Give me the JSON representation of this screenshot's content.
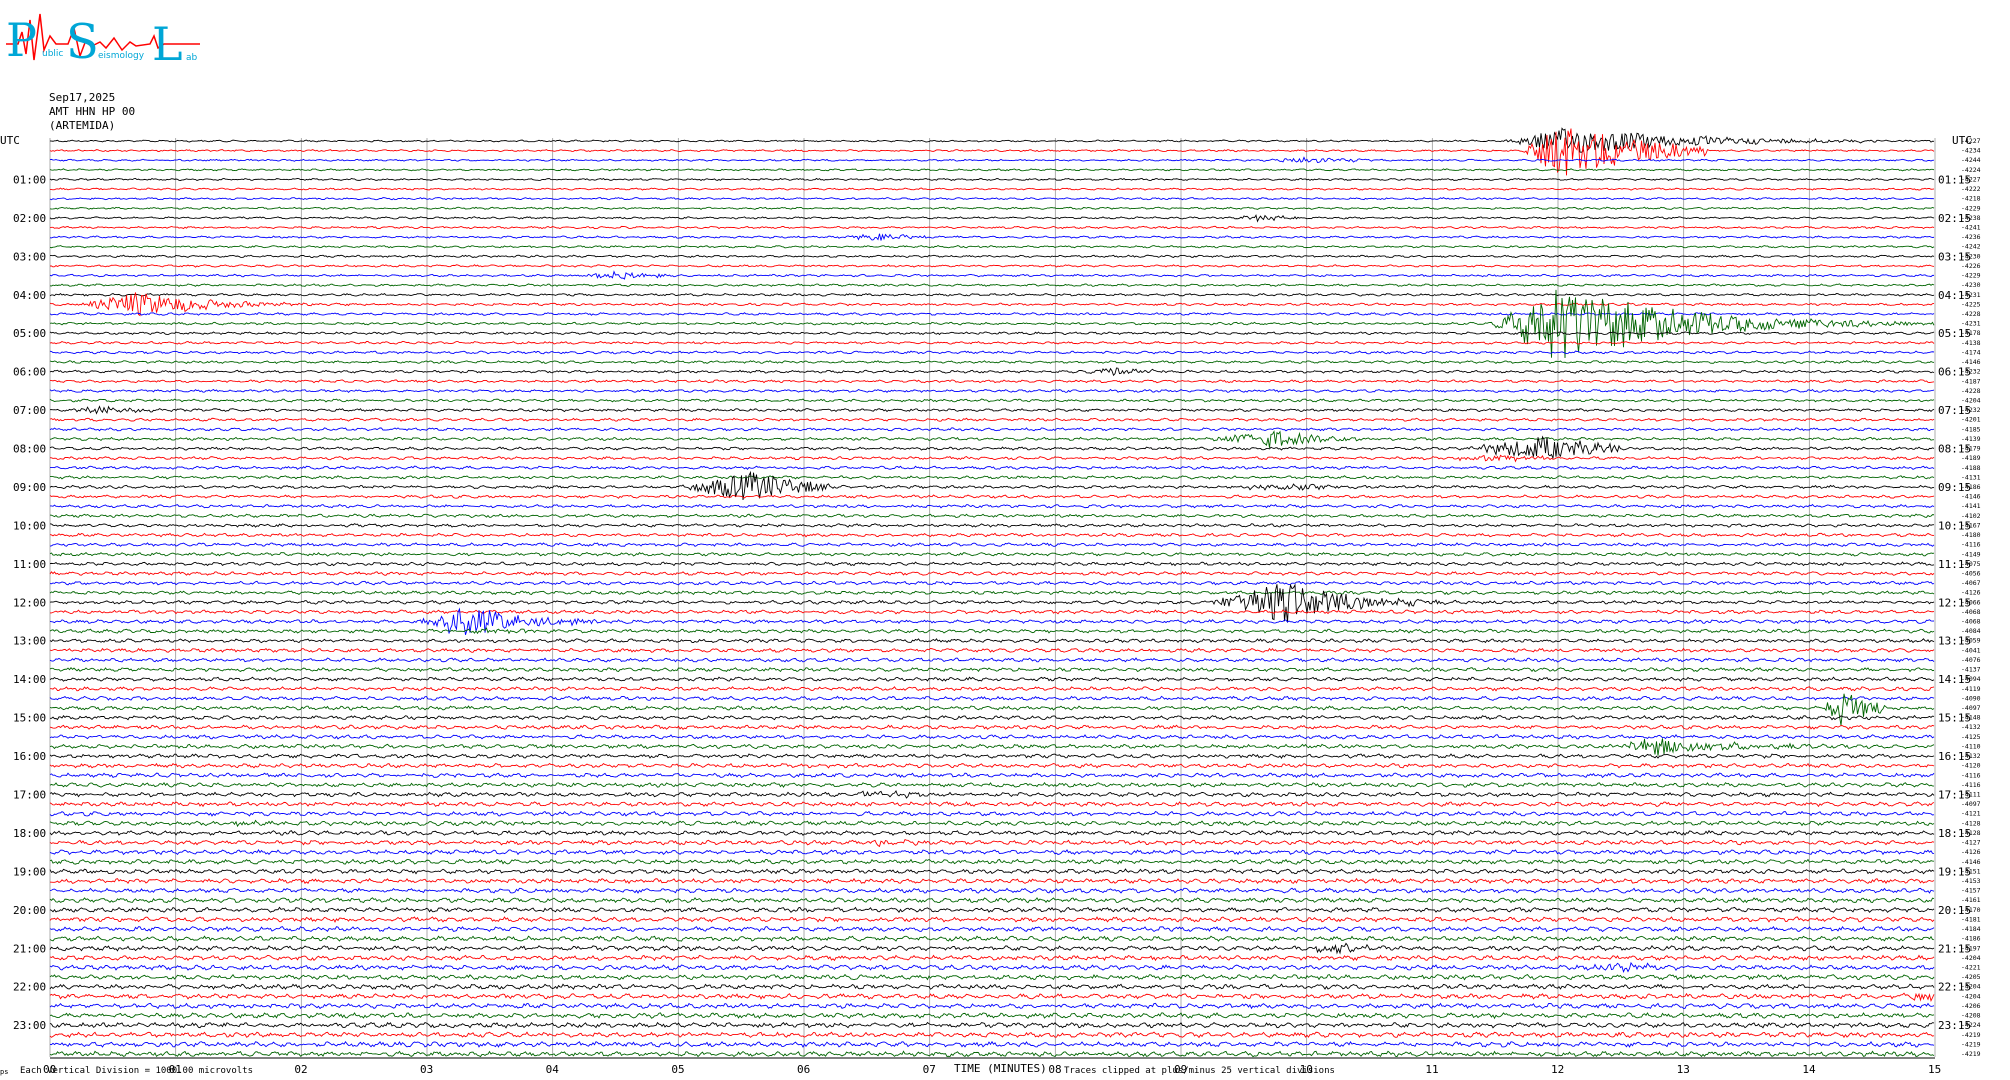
{
  "logo": {
    "letters": [
      "P",
      "S",
      "L"
    ],
    "words": [
      "ublic",
      "eismology",
      "ab"
    ]
  },
  "header": {
    "date": "Sep17,2025",
    "station": "AMT HHN HP 00",
    "location": "(ARTEMIDA)"
  },
  "axis": {
    "utc_label_left": "UTC",
    "utc_label_right": "UTC"
  },
  "footer": {
    "mark": "ps",
    "vertical_division": "Each Vertical Division = 1000.00 microvolts",
    "time_label": "TIME (MINUTES)",
    "clip_note": "Traces clipped at plus/minus 25 vertical divisions"
  },
  "chart_data": {
    "type": "line",
    "title": "",
    "xlabel": "TIME (MINUTES)",
    "ylabel": "UTC",
    "xlim": [
      0,
      15
    ],
    "x_ticks": [
      "00",
      "01",
      "02",
      "03",
      "04",
      "05",
      "06",
      "07",
      "08",
      "09",
      "10",
      "11",
      "12",
      "13",
      "14",
      "15"
    ],
    "left_hour_labels": [
      "01:00",
      "02:00",
      "03:00",
      "04:00",
      "05:00",
      "06:00",
      "07:00",
      "08:00",
      "09:00",
      "10:00",
      "11:00",
      "12:00",
      "13:00",
      "14:00",
      "15:00",
      "16:00",
      "17:00",
      "18:00",
      "19:00",
      "20:00",
      "21:00",
      "22:00",
      "23:00"
    ],
    "right_hour_labels": [
      "01:15",
      "02:15",
      "03:15",
      "04:15",
      "05:15",
      "06:15",
      "07:15",
      "08:15",
      "09:15",
      "10:15",
      "11:15",
      "12:15",
      "13:15",
      "14:15",
      "15:15",
      "16:15",
      "17:15",
      "18:15",
      "19:15",
      "20:15",
      "21:15",
      "22:15",
      "23:15"
    ],
    "trace_count": 96,
    "trace_minutes": 15,
    "trace_colors": [
      "#000000",
      "#ff0000",
      "#0000ff",
      "#006400"
    ],
    "right_values": [
      -4227,
      -4234,
      -4244,
      -4224,
      -4227,
      -4222,
      -4218,
      -4229,
      -4238,
      -4241,
      -4236,
      -4242,
      -4230,
      -4226,
      -4229,
      -4230,
      -4231,
      -4225,
      -4228,
      -4231,
      -4178,
      -4138,
      -4174,
      -4146,
      -4232,
      -4187,
      -4228,
      -4204,
      -4232,
      -4201,
      -4185,
      -4139,
      -4179,
      -4189,
      -4188,
      -4131,
      -4186,
      -4146,
      -4141,
      -4102,
      -4167,
      -4180,
      -4116,
      -4149,
      -4075,
      -4056,
      -4067,
      -4126,
      -4066,
      -4068,
      -4068,
      -4084,
      -4059,
      -4041,
      -4076,
      -4137,
      -4094,
      -4119,
      -4090,
      -4097,
      -4148,
      -4132,
      -4125,
      -4110,
      -4132,
      -4120,
      -4116,
      -4116,
      -4111,
      -4097,
      -4121,
      -4128,
      -4128,
      -4127,
      -4126,
      -4146,
      -4151,
      -4153,
      -4157,
      -4161,
      -4170,
      -4181,
      -4184,
      -4186,
      -4197,
      -4204,
      -4221,
      -4205,
      -4204,
      -4204,
      -4206,
      -4208,
      -4224,
      -4219,
      -4219,
      -4219
    ],
    "events": [
      {
        "trace": 0,
        "start_min": 11.55,
        "end_min": 15.0,
        "amp": 14,
        "peak_min": 12.1,
        "decay": 0.9
      },
      {
        "trace": 1,
        "start_min": 11.7,
        "end_min": 13.2,
        "amp": 28,
        "peak_min": 12.05,
        "decay": 0.6
      },
      {
        "trace": 2,
        "start_min": 9.7,
        "end_min": 10.5,
        "amp": 4,
        "peak_min": 10.0,
        "decay": 0.3
      },
      {
        "trace": 8,
        "start_min": 9.4,
        "end_min": 10.2,
        "amp": 3,
        "peak_min": 9.6,
        "decay": 0.3
      },
      {
        "trace": 10,
        "start_min": 6.3,
        "end_min": 7.0,
        "amp": 4,
        "peak_min": 6.6,
        "decay": 0.3
      },
      {
        "trace": 14,
        "start_min": 4.2,
        "end_min": 4.9,
        "amp": 4,
        "peak_min": 4.5,
        "decay": 0.3
      },
      {
        "trace": 17,
        "start_min": 0.2,
        "end_min": 2.3,
        "amp": 13,
        "peak_min": 0.7,
        "decay": 0.5
      },
      {
        "trace": 19,
        "start_min": 11.45,
        "end_min": 15.0,
        "amp": 40,
        "peak_min": 12.0,
        "decay": 0.9
      },
      {
        "trace": 24,
        "start_min": 8.2,
        "end_min": 8.9,
        "amp": 4,
        "peak_min": 8.45,
        "decay": 0.3
      },
      {
        "trace": 28,
        "start_min": 0.1,
        "end_min": 0.9,
        "amp": 4,
        "peak_min": 0.4,
        "decay": 0.3
      },
      {
        "trace": 31,
        "start_min": 9.2,
        "end_min": 10.4,
        "amp": 9,
        "peak_min": 9.7,
        "decay": 0.4
      },
      {
        "trace": 32,
        "start_min": 11.2,
        "end_min": 12.5,
        "amp": 12,
        "peak_min": 11.9,
        "decay": 0.5
      },
      {
        "trace": 33,
        "start_min": 11.1,
        "end_min": 11.9,
        "amp": 4,
        "peak_min": 11.5,
        "decay": 0.3
      },
      {
        "trace": 36,
        "start_min": 5.0,
        "end_min": 6.2,
        "amp": 16,
        "peak_min": 5.6,
        "decay": 0.4
      },
      {
        "trace": 36,
        "start_min": 9.3,
        "end_min": 10.5,
        "amp": 3,
        "peak_min": 9.8,
        "decay": 0.4
      },
      {
        "trace": 48,
        "start_min": 9.2,
        "end_min": 11.2,
        "amp": 22,
        "peak_min": 9.8,
        "decay": 0.5
      },
      {
        "trace": 50,
        "start_min": 2.9,
        "end_min": 4.4,
        "amp": 16,
        "peak_min": 3.3,
        "decay": 0.45
      },
      {
        "trace": 51,
        "start_min": 3.3,
        "end_min": 3.9,
        "amp": 3,
        "peak_min": 3.6,
        "decay": 0.3
      },
      {
        "trace": 59,
        "start_min": 14.1,
        "end_min": 14.6,
        "amp": 18,
        "peak_min": 14.25,
        "decay": 0.25
      },
      {
        "trace": 63,
        "start_min": 12.4,
        "end_min": 14.2,
        "amp": 9,
        "peak_min": 12.8,
        "decay": 0.5
      },
      {
        "trace": 68,
        "start_min": 6.3,
        "end_min": 7.0,
        "amp": 3,
        "peak_min": 6.6,
        "decay": 0.3
      },
      {
        "trace": 71,
        "start_min": 1.3,
        "end_min": 2.0,
        "amp": 3,
        "peak_min": 1.6,
        "decay": 0.3
      },
      {
        "trace": 73,
        "start_min": 6.3,
        "end_min": 7.0,
        "amp": 3,
        "peak_min": 6.6,
        "decay": 0.3
      },
      {
        "trace": 84,
        "start_min": 10.0,
        "end_min": 10.6,
        "amp": 5,
        "peak_min": 10.2,
        "decay": 0.3
      },
      {
        "trace": 86,
        "start_min": 12.2,
        "end_min": 13.0,
        "amp": 5,
        "peak_min": 12.5,
        "decay": 0.3
      },
      {
        "trace": 89,
        "start_min": 14.7,
        "end_min": 15.0,
        "amp": 5,
        "peak_min": 14.85,
        "decay": 0.3
      }
    ]
  }
}
